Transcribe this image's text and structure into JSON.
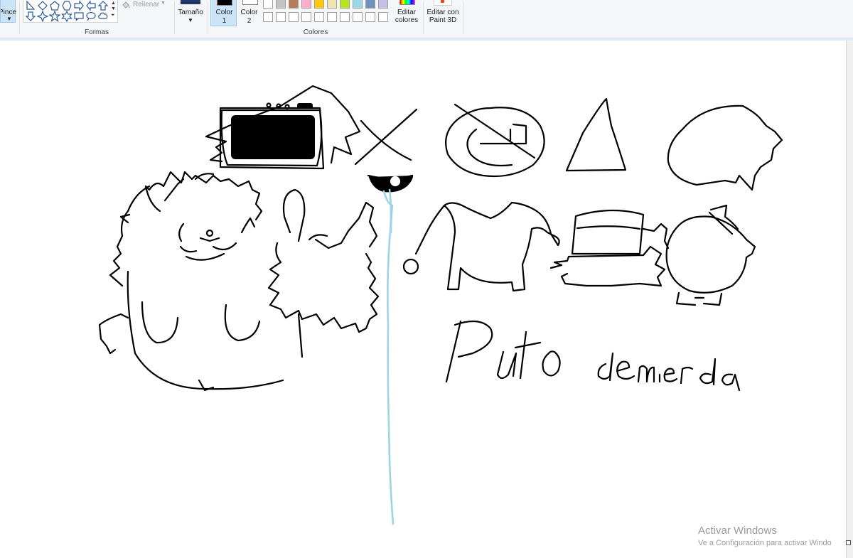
{
  "ribbon": {
    "pinceles_label": "Pinceles",
    "shapes_group_label": "Formas",
    "rellenar_label": "Rellenar",
    "tamano_label": "Tamaño",
    "color1_label_line1": "Color",
    "color1_label_line2": "1",
    "color2_label_line1": "Color",
    "color2_label_line2": "2",
    "colors_group_label": "Colores",
    "editar_colores_line1": "Editar",
    "editar_colores_line2": "colores",
    "paint3d_line1": "Editar con",
    "paint3d_line2": "Paint 3D",
    "shapes": [
      "right-triangle-icon",
      "diamond-icon",
      "pentagon-icon",
      "hexagon-icon",
      "arrow-left-icon",
      "arrow-up-icon",
      "arrow-down-icon",
      "four-point-star-icon",
      "five-point-star-icon",
      "six-point-star-icon",
      "rect-callout-icon",
      "oval-callout-icon",
      "cloud-callout-icon"
    ],
    "palette_row1": [
      "#ffffff",
      "#c3c3c3",
      "#b97a57",
      "#ffaec9",
      "#ffc90e",
      "#efe4b0",
      "#b5e61d",
      "#99d9ea",
      "#7092be",
      "#c8bfe7"
    ],
    "palette_row2": [
      "#ffffff",
      "#ffffff",
      "#ffffff",
      "#ffffff",
      "#ffffff",
      "#ffffff",
      "#ffffff",
      "#ffffff",
      "#ffffff",
      "#ffffff"
    ],
    "accent": "#cce4f7"
  },
  "canvas": {
    "handwritten_text": "Puto de mierda"
  },
  "watermark": {
    "title": "Activar Windows",
    "subtitle": "Ve a Configuración para activar Windo"
  }
}
